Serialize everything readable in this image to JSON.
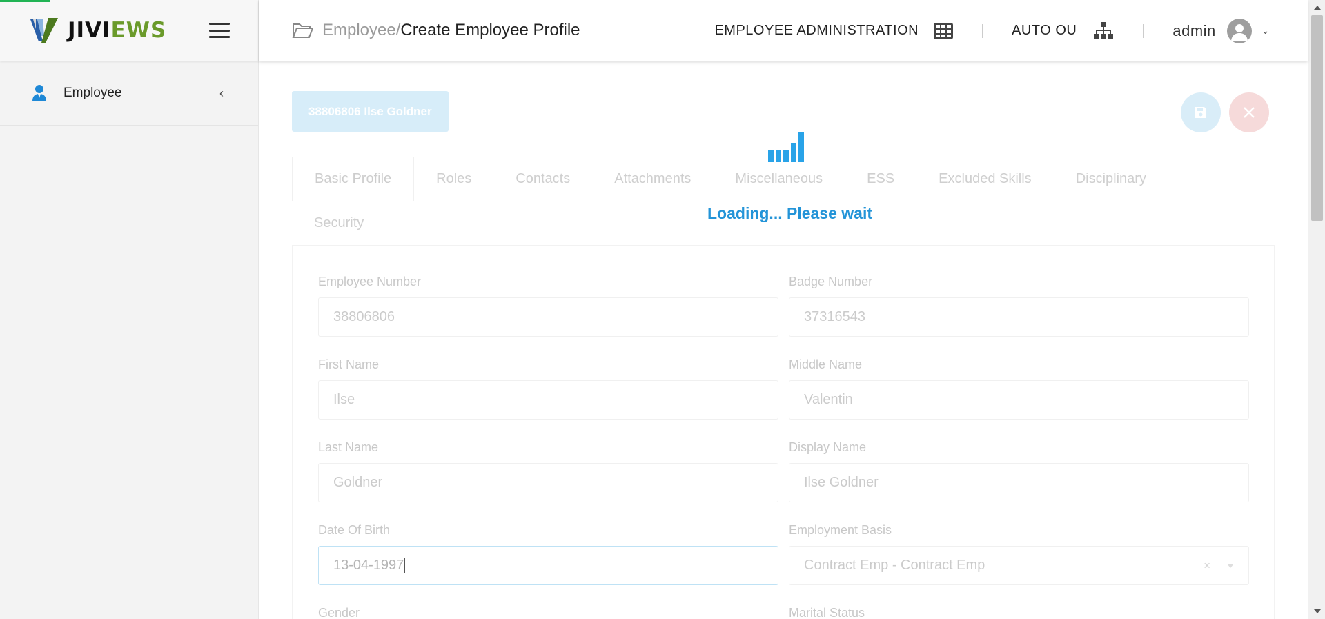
{
  "app": {
    "logo_a": "JIVI",
    "logo_b": "EWS"
  },
  "sidebar": {
    "items": [
      {
        "label": "Employee",
        "icon": "user-icon"
      }
    ]
  },
  "breadcrumb": {
    "parent": "Employee/",
    "current": "Create Employee Profile"
  },
  "header": {
    "module": "EMPLOYEE ADMINISTRATION",
    "ou": "AUTO OU",
    "user": "admin"
  },
  "employee_badge": "38806806 Ilse Goldner",
  "tabs": [
    {
      "label": "Basic Profile",
      "active": true
    },
    {
      "label": "Roles"
    },
    {
      "label": "Contacts"
    },
    {
      "label": "Attachments"
    },
    {
      "label": "Miscellaneous"
    },
    {
      "label": "ESS"
    },
    {
      "label": "Excluded Skills"
    },
    {
      "label": "Disciplinary"
    },
    {
      "label": "Security"
    }
  ],
  "form": {
    "employee_number": {
      "label": "Employee Number",
      "value": "38806806"
    },
    "badge_number": {
      "label": "Badge Number",
      "value": "37316543"
    },
    "first_name": {
      "label": "First Name",
      "value": "Ilse"
    },
    "middle_name": {
      "label": "Middle Name",
      "value": "Valentin"
    },
    "last_name": {
      "label": "Last Name",
      "value": "Goldner"
    },
    "display_name": {
      "label": "Display Name",
      "value": "Ilse Goldner"
    },
    "date_of_birth": {
      "label": "Date Of Birth",
      "value": "13-04-1997"
    },
    "employment_basis": {
      "label": "Employment Basis",
      "value": "Contract Emp - Contract Emp",
      "clear": "×"
    },
    "gender": {
      "label": "Gender"
    },
    "marital_status": {
      "label": "Marital Status"
    }
  },
  "loading": {
    "text": "Loading... Please wait"
  },
  "colors": {
    "accent": "#2394d8",
    "progress": "#22b455",
    "brand_green": "#6a9a2a"
  }
}
